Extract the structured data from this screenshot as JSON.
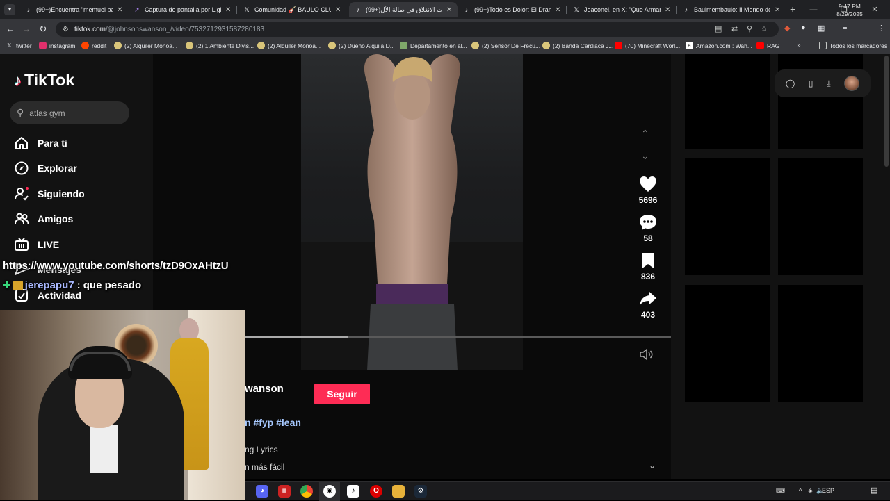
{
  "browser": {
    "tabs": [
      {
        "label": "(99+)Encuentra \"memuel bautis",
        "icon": "tiktok-icon"
      },
      {
        "label": "Captura de pantalla por Lightsh",
        "icon": "lightshot-icon"
      },
      {
        "label": "Comunidad 🎸 BAULO CLUB🎸",
        "icon": "x-icon"
      },
      {
        "label": "(99+)وقت الانغلاق في صالة الأل",
        "icon": "tiktok-icon"
      },
      {
        "label": "(99+)Todo es Dolor: El Drama e",
        "icon": "tiktok-icon"
      },
      {
        "label": "Joaconel. en X: \"Que Armani ar",
        "icon": "x-icon"
      },
      {
        "label": "Baulmembaulo: Il Mondo dei B",
        "icon": "tiktok-icon"
      }
    ],
    "active_tab_index": 3,
    "url_host": "tiktok.com",
    "url_path": "/@johnsonswanson_/video/7532712931587280183",
    "bookmarks": [
      {
        "label": "twitter",
        "icon": "x-icon",
        "color": "#ffffff"
      },
      {
        "label": "instagram",
        "icon": "instagram-icon",
        "color": "#e1306c"
      },
      {
        "label": "reddit",
        "icon": "reddit-icon",
        "color": "#ff4500"
      },
      {
        "label": "(2) Alquiler Monoa...",
        "icon": "listing-icon",
        "color": "#d9c57a"
      },
      {
        "label": "(2) 1 Ambiente Divis...",
        "icon": "listing-icon",
        "color": "#d9c57a"
      },
      {
        "label": "(2) Alquiler Monoa...",
        "icon": "listing-icon",
        "color": "#d9c57a"
      },
      {
        "label": "(2) Dueño Alquila D...",
        "icon": "listing-icon",
        "color": "#d9c57a"
      },
      {
        "label": "Departamento en al...",
        "icon": "image-icon",
        "color": "#7fa86a"
      },
      {
        "label": "(2) Sensor De Frecu...",
        "icon": "listing-icon",
        "color": "#d9c57a"
      },
      {
        "label": "(2) Banda Cardiaca J...",
        "icon": "listing-icon",
        "color": "#d9c57a"
      },
      {
        "label": "(70) Minecraft Worl...",
        "icon": "youtube-icon",
        "color": "#ff0000"
      },
      {
        "label": "Amazon.com : Wah...",
        "icon": "amazon-icon",
        "color": "#ffffff"
      },
      {
        "label": "RAG",
        "icon": "youtube-icon",
        "color": "#ff0000"
      }
    ],
    "all_bookmarks_label": "Todos los marcadores"
  },
  "tiktok": {
    "logo": "TikTok",
    "search_value": "atlas gym",
    "nav": [
      {
        "label": "Para ti",
        "icon": "home-icon"
      },
      {
        "label": "Explorar",
        "icon": "compass-icon"
      },
      {
        "label": "Siguiendo",
        "icon": "following-icon"
      },
      {
        "label": "Amigos",
        "icon": "friends-icon"
      },
      {
        "label": "LIVE",
        "icon": "live-icon"
      },
      {
        "label": "Mensajes",
        "icon": "messages-icon"
      },
      {
        "label": "Actividad",
        "icon": "activity-icon"
      }
    ],
    "actions": {
      "likes": "5696",
      "comments": "58",
      "saves": "836",
      "shares": "403"
    },
    "progress": 0.24,
    "author": "wanson_",
    "follow_label": "Seguir",
    "tags": "n #fyp #lean",
    "sound": "ng Lyrics",
    "sound2": "n más fácil"
  },
  "overlay": {
    "chat_link": "https://www.youtube.com/shorts/tzD9OxAHtzU",
    "chat_user": "jerepapu7",
    "chat_message": ": que pesado"
  },
  "taskbar": {
    "lang": "ESP",
    "time": "9:47 PM",
    "date": "8/29/2025"
  },
  "colors": {
    "accent": "#fe2c55",
    "tag": "#a7c9ff"
  }
}
